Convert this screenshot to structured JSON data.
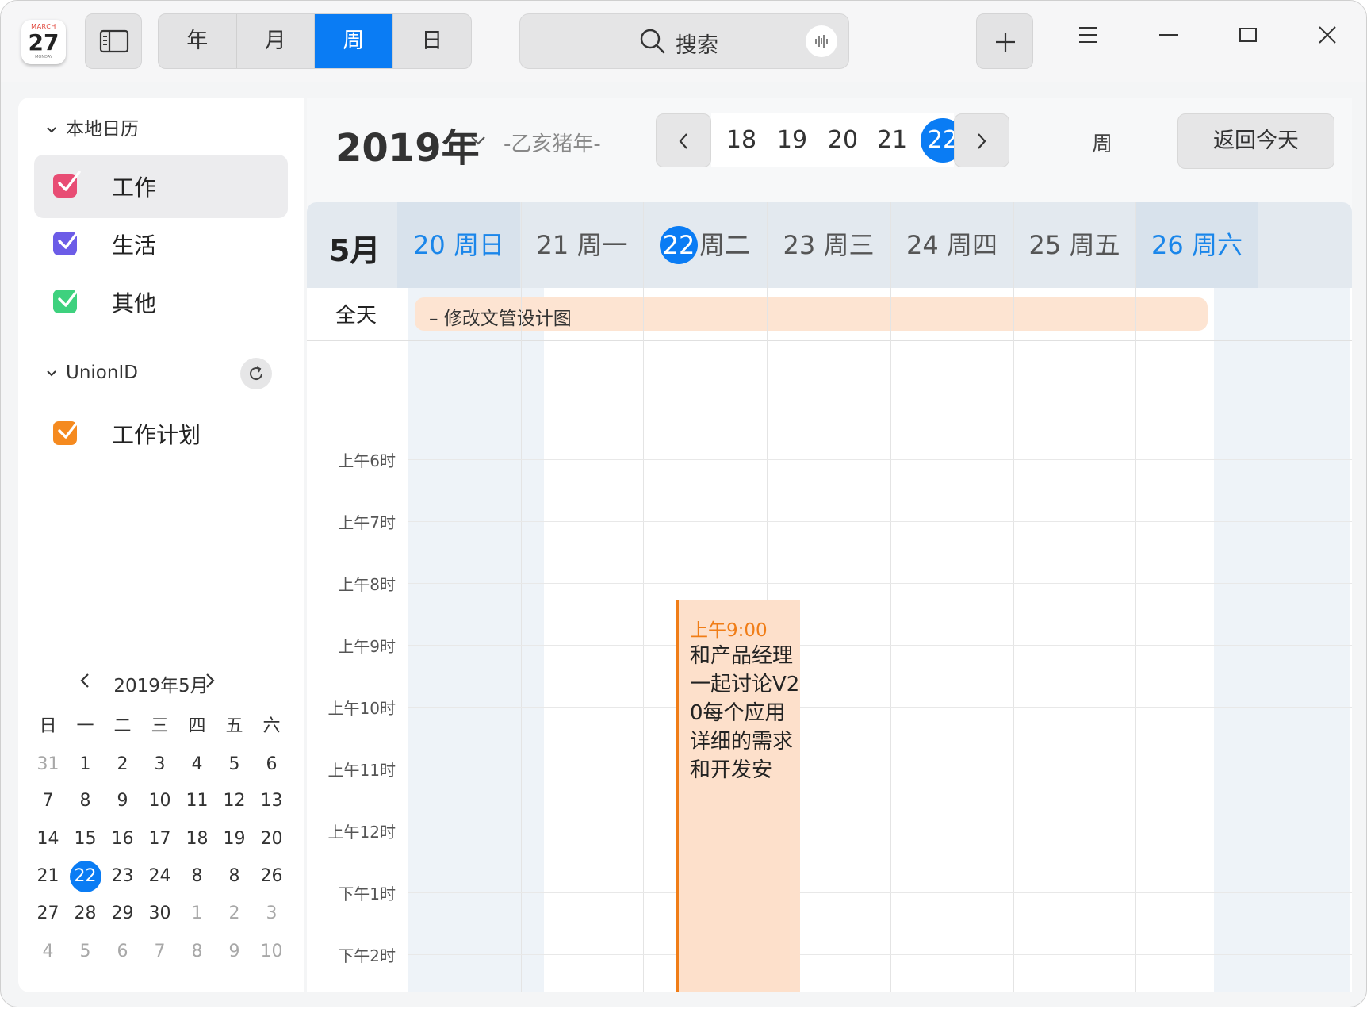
{
  "app": {
    "icon_month": "MARCH",
    "icon_day": "27",
    "icon_weekday": "MONDAY"
  },
  "toolbar": {
    "tabs": [
      "年",
      "月",
      "周",
      "日"
    ],
    "active_tab": "周",
    "search_label": "搜索"
  },
  "sidebar": {
    "group_local": "本地日历",
    "local_calendars": [
      {
        "label": "工作",
        "color": "#e84d74",
        "selected": true
      },
      {
        "label": "生活",
        "color": "#6c5ce7",
        "selected": false
      },
      {
        "label": "其他",
        "color": "#3ed17e",
        "selected": false
      }
    ],
    "group_union": "UnionID",
    "union_calendars": [
      {
        "label": "工作计划",
        "color": "#f58a1f"
      }
    ]
  },
  "mini_calendar": {
    "title": "2019年5月",
    "weekdays": [
      "日",
      "一",
      "二",
      "三",
      "四",
      "五",
      "六"
    ],
    "weeks": [
      [
        "31",
        "1",
        "2",
        "3",
        "4",
        "5",
        "6"
      ],
      [
        "7",
        "8",
        "9",
        "10",
        "11",
        "12",
        "13"
      ],
      [
        "14",
        "15",
        "16",
        "17",
        "18",
        "19",
        "20"
      ],
      [
        "21",
        "22",
        "23",
        "24",
        "8",
        "8",
        "26"
      ],
      [
        "27",
        "28",
        "29",
        "30",
        "1",
        "2",
        "3"
      ],
      [
        "4",
        "5",
        "6",
        "7",
        "8",
        "9",
        "10"
      ]
    ],
    "today": "22"
  },
  "header": {
    "year": "2019年",
    "lunar_year": "-乙亥猪年-",
    "week_numbers": [
      "18",
      "19",
      "20",
      "21",
      "22"
    ],
    "current_week": "22",
    "week_suffix": "周",
    "today_button": "返回今天"
  },
  "week_view": {
    "month_label": "5月",
    "days": [
      {
        "num": "20",
        "label": "周日",
        "weekend": true,
        "today": false
      },
      {
        "num": "21",
        "label": "周一",
        "weekend": false,
        "today": false
      },
      {
        "num": "22",
        "label": "周二",
        "weekend": false,
        "today": true
      },
      {
        "num": "23",
        "label": "周三",
        "weekend": false,
        "today": false
      },
      {
        "num": "24",
        "label": "周四",
        "weekend": false,
        "today": false
      },
      {
        "num": "25",
        "label": "周五",
        "weekend": false,
        "today": false
      },
      {
        "num": "26",
        "label": "周六",
        "weekend": true,
        "today": false
      }
    ],
    "allday_label": "全天",
    "allday_event": "– 修改文管设计图",
    "time_labels": [
      "上午6时",
      "上午7时",
      "上午8时",
      "上午9时",
      "上午10时",
      "上午11时",
      "上午12时",
      "下午1时",
      "下午2时"
    ],
    "event": {
      "time": "上午9:00",
      "title": "和产品经理一起讨论V20每个应用详细的需求和开发安",
      "color": "#f07d17"
    }
  }
}
